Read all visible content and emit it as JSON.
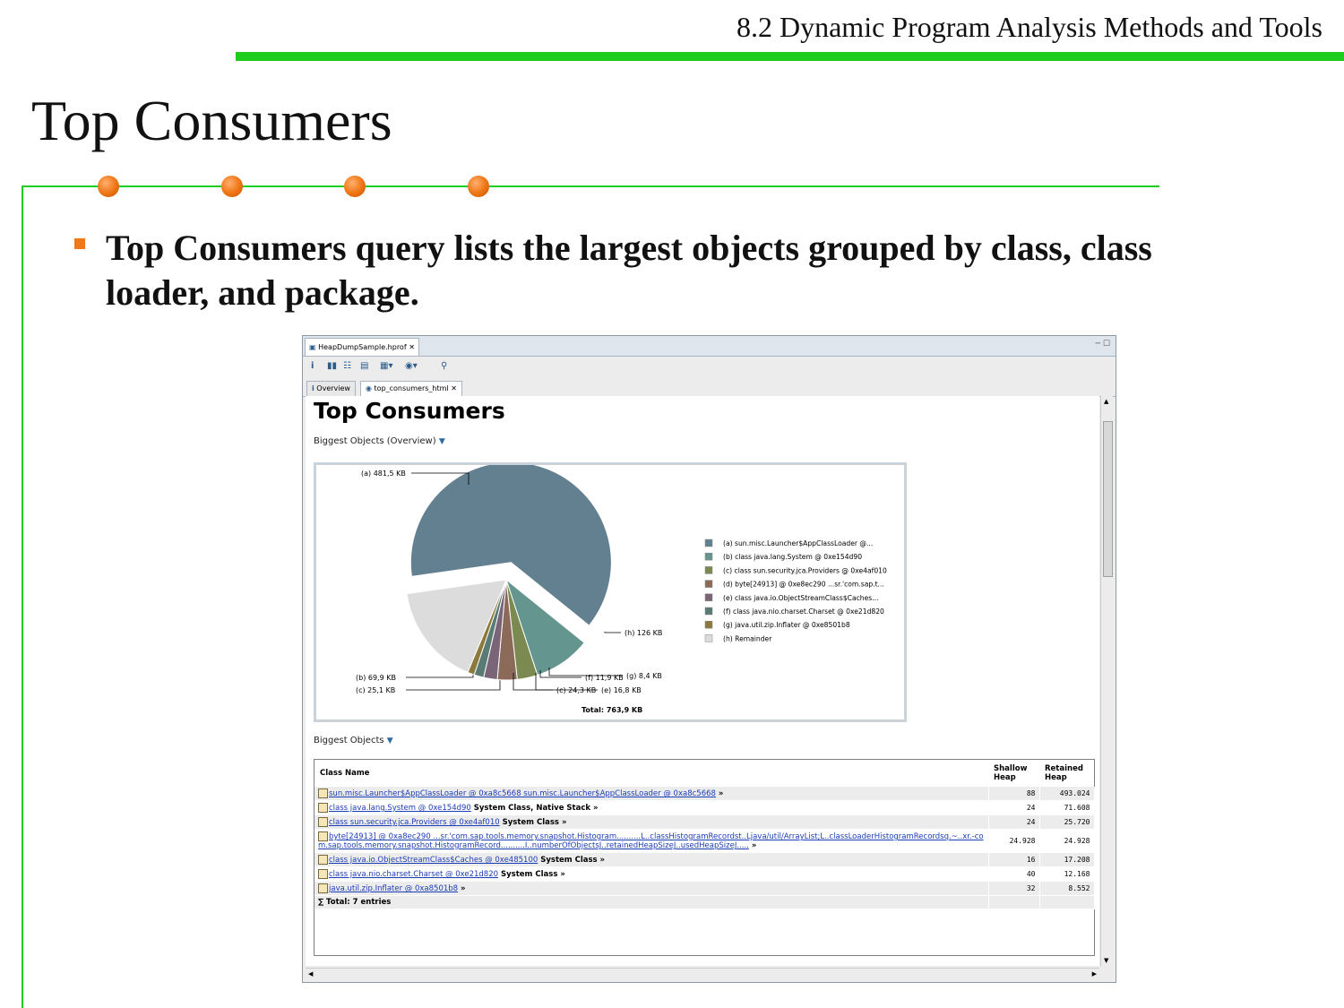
{
  "slide": {
    "header": "8.2 Dynamic Program Analysis Methods and Tools",
    "title": "Top Consumers",
    "bullet": "Top Consumers query lists the largest objects grouped by class, class loader, and package."
  },
  "window": {
    "editor_tab": "HeapDumpSample.hprof",
    "view_tabs": [
      "Overview",
      "top_consumers_html"
    ],
    "content_title": "Top Consumers",
    "section_overview": "Biggest Objects (Overview)",
    "section_table": "Biggest Objects"
  },
  "chart_data": {
    "type": "pie",
    "total_label": "Total: 763,9 KB",
    "slices": [
      {
        "tag": "(a) 481,5 KB",
        "value": 481.5,
        "color": "#62808f"
      },
      {
        "tag": "(b) 69,9 KB",
        "value": 69.9,
        "color": "#64958f"
      },
      {
        "tag": "(c) 25,1 KB",
        "value": 25.1,
        "color": "#7a8a50"
      },
      {
        "tag": "(c) 24,3 KB",
        "value": 24.3,
        "color": "#8c6a5a"
      },
      {
        "tag": "(e) 16,8 KB",
        "value": 16.8,
        "color": "#7a6478"
      },
      {
        "tag": "(f) 11,9 KB",
        "value": 11.9,
        "color": "#5a7a74"
      },
      {
        "tag": "(g) 8,4 KB",
        "value": 8.4,
        "color": "#8c7a3c"
      },
      {
        "tag": "(h) 126 KB",
        "value": 126,
        "color": "#dcdcdc"
      }
    ],
    "legend": [
      "(a) sun.misc.Launcher$AppClassLoader @...",
      "(b) class java.lang.System @ 0xe154d90",
      "(c) class sun.security.jca.Providers @ 0xe4af010",
      "(d) byte[24913] @ 0xe8ec290 ...sr.'com.sap.t...",
      "(e) class java.io.ObjectStreamClass$Caches...",
      "(f) class java.nio.charset.Charset @ 0xe21d820",
      "(g) java.util.zip.Inflater @ 0xe8501b8",
      "(h) Remainder"
    ]
  },
  "table": {
    "headers": {
      "class_name": "Class Name",
      "shallow": "Shallow Heap",
      "retained": "Retained Heap"
    },
    "rows": [
      {
        "link": "sun.misc.Launcher$AppClassLoader @ 0xa8c5668 sun.misc.Launcher$AppClassLoader @ 0xa8c5668",
        "suffix": " »",
        "shallow": "88",
        "retained": "493.024"
      },
      {
        "link": "class java.lang.System @ 0xe154d90",
        "suffix": " System Class, Native Stack »",
        "shallow": "24",
        "retained": "71.608"
      },
      {
        "link": "class sun.security.jca.Providers @ 0xe4af010",
        "suffix": " System Class »",
        "shallow": "24",
        "retained": "25.720"
      },
      {
        "link": "byte[24913] @ 0xa8ec290 ...sr.'com.sap.tools.memory.snapshot.Histogram..........L..classHistogramRecordst..Ljava/util/ArrayList;L..classLoaderHistogramRecordsq.~..xr.-com.sap.tools.memory.snapshot.HistogramRecord..........I..numberOfObjectsJ..retainedHeapSizeJ..usedHeapSizeJ.....",
        "suffix": " »",
        "shallow": "24.928",
        "retained": "24.928"
      },
      {
        "link": "class java.io.ObjectStreamClass$Caches @ 0xe485100",
        "suffix": " System Class »",
        "shallow": "16",
        "retained": "17.208"
      },
      {
        "link": "class java.nio.charset.Charset @ 0xe21d820",
        "suffix": " System Class »",
        "shallow": "40",
        "retained": "12.168"
      },
      {
        "link": "java.util.zip.Inflater @ 0xa8501b8",
        "suffix": " »",
        "shallow": "32",
        "retained": "8.552"
      }
    ],
    "total": "∑ Total: 7 entries"
  }
}
